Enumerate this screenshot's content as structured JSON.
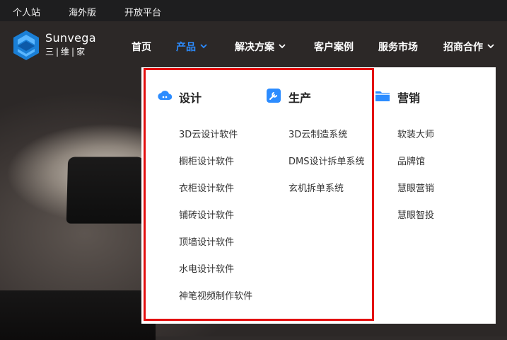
{
  "topbar": {
    "links": [
      "个人站",
      "海外版",
      "开放平台"
    ]
  },
  "logo": {
    "en": "Sunvega",
    "cn": "三|维|家"
  },
  "nav": {
    "items": [
      {
        "label": "首页",
        "dropdown": false,
        "active": false
      },
      {
        "label": "产品",
        "dropdown": true,
        "active": true
      },
      {
        "label": "解决方案",
        "dropdown": true,
        "active": false
      },
      {
        "label": "客户案例",
        "dropdown": false,
        "active": false
      },
      {
        "label": "服务市场",
        "dropdown": false,
        "active": false
      },
      {
        "label": "招商合作",
        "dropdown": true,
        "active": false
      }
    ]
  },
  "menu": {
    "columns": [
      {
        "title": "设计",
        "icon": "cloud-icon",
        "items": [
          "3D云设计软件",
          "橱柜设计软件",
          "衣柜设计软件",
          "铺砖设计软件",
          "顶墙设计软件",
          "水电设计软件",
          "神笔视频制作软件"
        ]
      },
      {
        "title": "生产",
        "icon": "wrench-icon",
        "items": [
          "3D云制造系统",
          "DMS设计拆单系统",
          "玄机拆单系统"
        ]
      },
      {
        "title": "营销",
        "icon": "folder-icon",
        "items": [
          "软装大师",
          "品牌馆",
          "慧眼营销",
          "慧眼智投"
        ]
      }
    ]
  },
  "colors": {
    "accent": "#2c8cff",
    "highlight": "#e30f0f",
    "topbar": "#1e1e1f"
  }
}
